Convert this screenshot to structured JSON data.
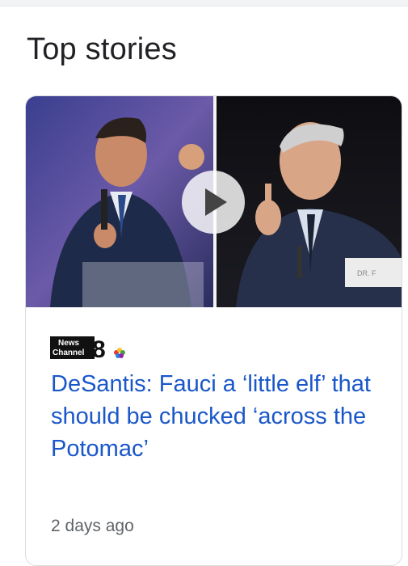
{
  "section": {
    "title": "Top stories"
  },
  "story": {
    "publisher": {
      "logo_text_line1": "News",
      "logo_text_line2": "Channel",
      "logo_number": "8",
      "logo_icon": "peacock-icon"
    },
    "headline": "DeSantis: Fauci a ‘little elf’ that should be chucked ‘across the Potomac’",
    "time": "2 days ago",
    "media": {
      "type": "video",
      "play_icon": "play-icon"
    }
  }
}
